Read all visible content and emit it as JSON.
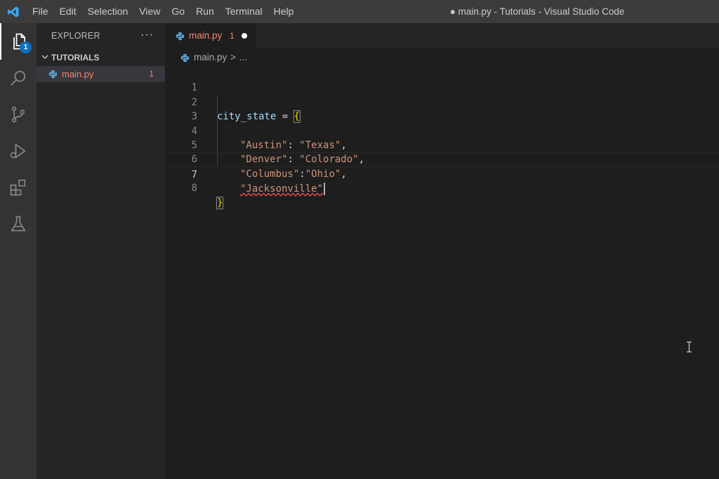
{
  "titlebar": {
    "menu": [
      "File",
      "Edit",
      "Selection",
      "View",
      "Go",
      "Run",
      "Terminal",
      "Help"
    ],
    "window_title": "● main.py - Tutorials - Visual Studio Code"
  },
  "activitybar": {
    "explorer_badge": "1",
    "icons": [
      "explorer-icon",
      "search-icon",
      "source-control-icon",
      "run-debug-icon",
      "extensions-icon",
      "testing-icon"
    ]
  },
  "sidebar": {
    "header": "EXPLORER",
    "more": "···",
    "folder": "TUTORIALS",
    "file": {
      "name": "main.py",
      "problems": "1"
    }
  },
  "tab": {
    "name": "main.py",
    "problems": "1"
  },
  "breadcrumb": {
    "file": "main.py",
    "separator": ">",
    "rest": "..."
  },
  "editor": {
    "lines": [
      {
        "num": "1"
      },
      {
        "num": "2",
        "var": "city_state",
        "op": " = ",
        "brace": "{"
      },
      {
        "num": "3"
      },
      {
        "num": "4",
        "key": "\"Austin\"",
        "sep": ": ",
        "val": "\"Texas\"",
        "end": ","
      },
      {
        "num": "5",
        "key": "\"Denver\"",
        "sep": ": ",
        "val": "\"Colorado\"",
        "end": ","
      },
      {
        "num": "6",
        "key": "\"Columbus\"",
        "sep": ":",
        "val": "\"Ohio\"",
        "end": ","
      },
      {
        "num": "7",
        "key": "\"Jacksonville\""
      },
      {
        "num": "8",
        "brace": "}"
      }
    ]
  },
  "colors": {
    "activity_bar": "#333333",
    "sidebar": "#252526",
    "editor": "#1e1e1e",
    "error": "#f48771",
    "badge": "#0e70c0"
  }
}
